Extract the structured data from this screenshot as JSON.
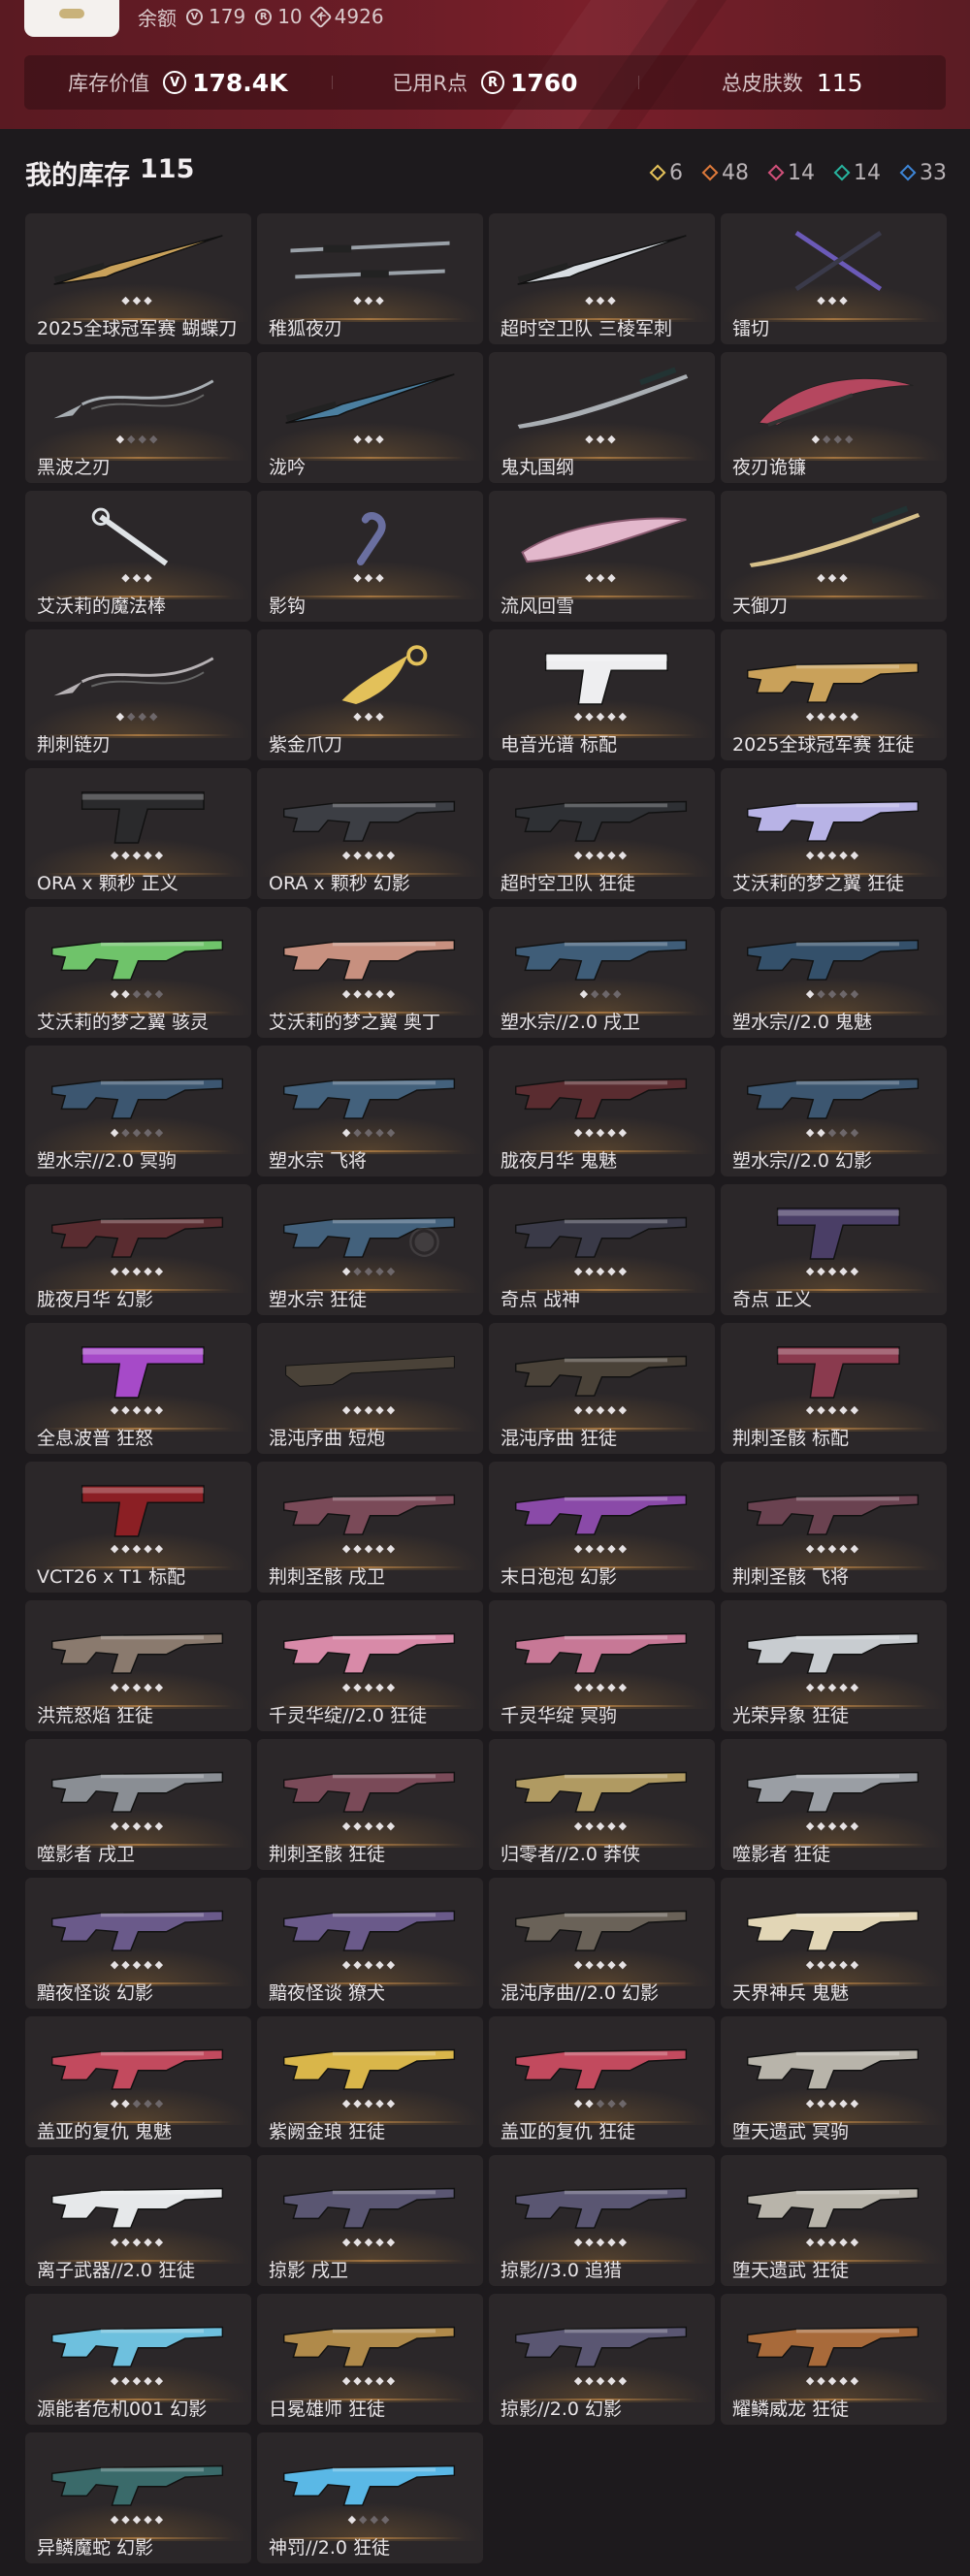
{
  "header": {
    "balance_label": "余额",
    "balances": [
      {
        "icon": "vp-coin-icon",
        "value": "179"
      },
      {
        "icon": "radianite-icon",
        "value": "10"
      },
      {
        "icon": "kingdom-credit-icon",
        "value": "4926"
      }
    ],
    "stats": [
      {
        "label": "库存价值",
        "value": "178.4K",
        "icon": "vp-coin-icon"
      },
      {
        "label": "已用R点",
        "value": "1760",
        "icon": "r-point-icon"
      },
      {
        "label": "总皮肤数",
        "value": "115",
        "icon": ""
      }
    ]
  },
  "inventory": {
    "title": "我的库存",
    "count": "115",
    "tiers": [
      {
        "icon": "tier-exclusive-icon",
        "color": "#e6c35a",
        "count": "6"
      },
      {
        "icon": "tier-premium-icon",
        "color": "#e07a3a",
        "count": "48"
      },
      {
        "icon": "tier-ultra-icon",
        "color": "#d2507a",
        "count": "14"
      },
      {
        "icon": "tier-deluxe-icon",
        "color": "#27b5a0",
        "count": "14"
      },
      {
        "icon": "tier-select-icon",
        "color": "#3d86d8",
        "count": "33"
      }
    ]
  },
  "items": [
    {
      "name": "2025全球冠军赛 蝴蝶刀",
      "stars": 3,
      "filled": 3,
      "kind": "knife",
      "color": "#c9a15a"
    },
    {
      "name": "稚狐夜刃",
      "stars": 3,
      "filled": 3,
      "kind": "swords",
      "color": "#9aa1a8"
    },
    {
      "name": "超时空卫队 三棱军刺",
      "stars": 3,
      "filled": 3,
      "kind": "knife",
      "color": "#d8dde2"
    },
    {
      "name": "镭切",
      "stars": 3,
      "filled": 3,
      "kind": "cross",
      "color": "#6b5ab8"
    },
    {
      "name": "黑波之刃",
      "stars": 4,
      "filled": 1,
      "kind": "kunai",
      "color": "#a7adb2"
    },
    {
      "name": "泷吟",
      "stars": 3,
      "filled": 3,
      "kind": "knife",
      "color": "#4b7fa0"
    },
    {
      "name": "鬼丸国纲",
      "stars": 3,
      "filled": 3,
      "kind": "katana",
      "color": "#a9aeb3"
    },
    {
      "name": "夜刃诡镰",
      "stars": 4,
      "filled": 1,
      "kind": "scythe",
      "color": "#b5475f"
    },
    {
      "name": "艾沃莉的魔法棒",
      "stars": 3,
      "filled": 3,
      "kind": "wand",
      "color": "#dfe3e6"
    },
    {
      "name": "影钩",
      "stars": 3,
      "filled": 3,
      "kind": "hook",
      "color": "#6a6fa0"
    },
    {
      "name": "流风回雪",
      "stars": 3,
      "filled": 3,
      "kind": "blade",
      "color": "#e3b8cc"
    },
    {
      "name": "天御刀",
      "stars": 3,
      "filled": 3,
      "kind": "katana",
      "color": "#d6c08a"
    },
    {
      "name": "荆刺链刃",
      "stars": 4,
      "filled": 1,
      "kind": "kunai",
      "color": "#b6b1b4"
    },
    {
      "name": "紫金爪刀",
      "stars": 3,
      "filled": 3,
      "kind": "claw",
      "color": "#e3c15a"
    },
    {
      "name": "电音光谱 标配",
      "stars": 5,
      "filled": 5,
      "kind": "pistol",
      "color": "#eeeef0"
    },
    {
      "name": "2025全球冠军赛 狂徒",
      "stars": 5,
      "filled": 5,
      "kind": "rifle",
      "color": "#c9a15a"
    },
    {
      "name": "ORA x 颗秒 正义",
      "stars": 5,
      "filled": 5,
      "kind": "pistol",
      "color": "#2a2a2c"
    },
    {
      "name": "ORA x 颗秒 幻影",
      "stars": 5,
      "filled": 5,
      "kind": "rifle",
      "color": "#3c3e44"
    },
    {
      "name": "超时空卫队 狂徒",
      "stars": 5,
      "filled": 5,
      "kind": "rifle",
      "color": "#2e3034"
    },
    {
      "name": "艾沃莉的梦之翼 狂徒",
      "stars": 5,
      "filled": 5,
      "kind": "rifle",
      "color": "#b8b3e6"
    },
    {
      "name": "艾沃莉的梦之翼 骇灵",
      "stars": 5,
      "filled": 2,
      "kind": "rifle",
      "color": "#6fc36a"
    },
    {
      "name": "艾沃莉的梦之翼 奥丁",
      "stars": 5,
      "filled": 5,
      "kind": "rifle",
      "color": "#c7907f"
    },
    {
      "name": "塑水宗//2.0 戌卫",
      "stars": 4,
      "filled": 1,
      "kind": "rifle",
      "color": "#3f5d78"
    },
    {
      "name": "塑水宗//2.0 鬼魅",
      "stars": 5,
      "filled": 1,
      "kind": "rifle",
      "color": "#34506a"
    },
    {
      "name": "塑水宗//2.0 冥驹",
      "stars": 5,
      "filled": 1,
      "kind": "rifle",
      "color": "#3c5670"
    },
    {
      "name": "塑水宗 飞将",
      "stars": 5,
      "filled": 1,
      "kind": "rifle",
      "color": "#43617c"
    },
    {
      "name": "胧夜月华 鬼魅",
      "stars": 5,
      "filled": 5,
      "kind": "rifle",
      "color": "#5a2c30"
    },
    {
      "name": "塑水宗//2.0 幻影",
      "stars": 5,
      "filled": 2,
      "kind": "rifle",
      "color": "#3c5670"
    },
    {
      "name": "胧夜月华 幻影",
      "stars": 5,
      "filled": 5,
      "kind": "rifle",
      "color": "#5a2c30"
    },
    {
      "name": "塑水宗 狂徒",
      "stars": 5,
      "filled": 1,
      "kind": "rifle",
      "color": "#43617c"
    },
    {
      "name": "奇点 战神",
      "stars": 5,
      "filled": 5,
      "kind": "rifle",
      "color": "#3a3a48"
    },
    {
      "name": "奇点 正义",
      "stars": 5,
      "filled": 5,
      "kind": "pistol",
      "color": "#4a3e66"
    },
    {
      "name": "全息波普 狂怒",
      "stars": 5,
      "filled": 5,
      "kind": "pistol",
      "color": "#a64ac8"
    },
    {
      "name": "混沌序曲 短炮",
      "stars": 5,
      "filled": 5,
      "kind": "shotgun",
      "color": "#4a4238"
    },
    {
      "name": "混沌序曲 狂徒",
      "stars": 5,
      "filled": 5,
      "kind": "rifle",
      "color": "#4a4238"
    },
    {
      "name": "荆刺圣骸 标配",
      "stars": 5,
      "filled": 5,
      "kind": "pistol",
      "color": "#8a3a4e"
    },
    {
      "name": "VCT26 x T1 标配",
      "stars": 5,
      "filled": 5,
      "kind": "pistol",
      "color": "#8b1f24"
    },
    {
      "name": "荆刺圣骸 戌卫",
      "stars": 5,
      "filled": 5,
      "kind": "rifle",
      "color": "#7a4a58"
    },
    {
      "name": "末日泡泡 幻影",
      "stars": 5,
      "filled": 5,
      "kind": "rifle",
      "color": "#8a4aa8"
    },
    {
      "name": "荆刺圣骸 飞将",
      "stars": 5,
      "filled": 5,
      "kind": "rifle",
      "color": "#6a4250"
    },
    {
      "name": "洪荒怒焰 狂徒",
      "stars": 5,
      "filled": 5,
      "kind": "rifle",
      "color": "#8a7a6e"
    },
    {
      "name": "千灵华绽//2.0 狂徒",
      "stars": 5,
      "filled": 5,
      "kind": "rifle",
      "color": "#d88aa8"
    },
    {
      "name": "千灵华绽 冥驹",
      "stars": 5,
      "filled": 5,
      "kind": "rifle",
      "color": "#c77896"
    },
    {
      "name": "光荣异象 狂徒",
      "stars": 5,
      "filled": 5,
      "kind": "rifle",
      "color": "#c8ccd0"
    },
    {
      "name": "噬影者 戌卫",
      "stars": 5,
      "filled": 5,
      "kind": "rifle",
      "color": "#8a8e94"
    },
    {
      "name": "荆刺圣骸 狂徒",
      "stars": 5,
      "filled": 5,
      "kind": "rifle",
      "color": "#7a4a58"
    },
    {
      "name": "归零者//2.0 莽侠",
      "stars": 5,
      "filled": 5,
      "kind": "rifle",
      "color": "#b09a62"
    },
    {
      "name": "噬影者 狂徒",
      "stars": 5,
      "filled": 5,
      "kind": "rifle",
      "color": "#9a9ea4"
    },
    {
      "name": "黯夜怪谈 幻影",
      "stars": 5,
      "filled": 5,
      "kind": "rifle",
      "color": "#6a5a8a"
    },
    {
      "name": "黯夜怪谈 獠犬",
      "stars": 5,
      "filled": 5,
      "kind": "rifle",
      "color": "#6a5a8a"
    },
    {
      "name": "混沌序曲//2.0 幻影",
      "stars": 5,
      "filled": 5,
      "kind": "rifle",
      "color": "#6a6258"
    },
    {
      "name": "天界神兵 鬼魅",
      "stars": 5,
      "filled": 5,
      "kind": "rifle",
      "color": "#e2d6b6"
    },
    {
      "name": "盖亚的复仇 鬼魅",
      "stars": 5,
      "filled": 2,
      "kind": "rifle",
      "color": "#c24a5e"
    },
    {
      "name": "紫阙金琅 狂徒",
      "stars": 5,
      "filled": 5,
      "kind": "rifle",
      "color": "#d9b64a"
    },
    {
      "name": "盖亚的复仇 狂徒",
      "stars": 5,
      "filled": 2,
      "kind": "rifle",
      "color": "#c24a5e"
    },
    {
      "name": "堕天遗武 冥驹",
      "stars": 5,
      "filled": 5,
      "kind": "rifle",
      "color": "#b8b4aa"
    },
    {
      "name": "离子武器//2.0 狂徒",
      "stars": 5,
      "filled": 5,
      "kind": "rifle",
      "color": "#e6e8ea"
    },
    {
      "name": "掠影 戌卫",
      "stars": 5,
      "filled": 5,
      "kind": "rifle",
      "color": "#5a5672"
    },
    {
      "name": "掠影//3.0 追猎",
      "stars": 5,
      "filled": 5,
      "kind": "rifle",
      "color": "#5a5672"
    },
    {
      "name": "堕天遗武 狂徒",
      "stars": 5,
      "filled": 5,
      "kind": "rifle",
      "color": "#b8b4aa"
    },
    {
      "name": "源能者危机001 幻影",
      "stars": 5,
      "filled": 5,
      "kind": "rifle",
      "color": "#6ec0de"
    },
    {
      "name": "日冕雄师 狂徒",
      "stars": 5,
      "filled": 5,
      "kind": "rifle",
      "color": "#b08a4a"
    },
    {
      "name": "掠影//2.0 幻影",
      "stars": 5,
      "filled": 5,
      "kind": "rifle",
      "color": "#5a5672"
    },
    {
      "name": "耀鳞威龙 狂徒",
      "stars": 5,
      "filled": 5,
      "kind": "rifle",
      "color": "#a86a3a"
    },
    {
      "name": "异鳞魔蛇 幻影",
      "stars": 5,
      "filled": 5,
      "kind": "rifle",
      "color": "#3a6a6a"
    },
    {
      "name": "神罚//2.0 狂徒",
      "stars": 4,
      "filled": 1,
      "kind": "rifle",
      "color": "#5ab8e6"
    }
  ]
}
